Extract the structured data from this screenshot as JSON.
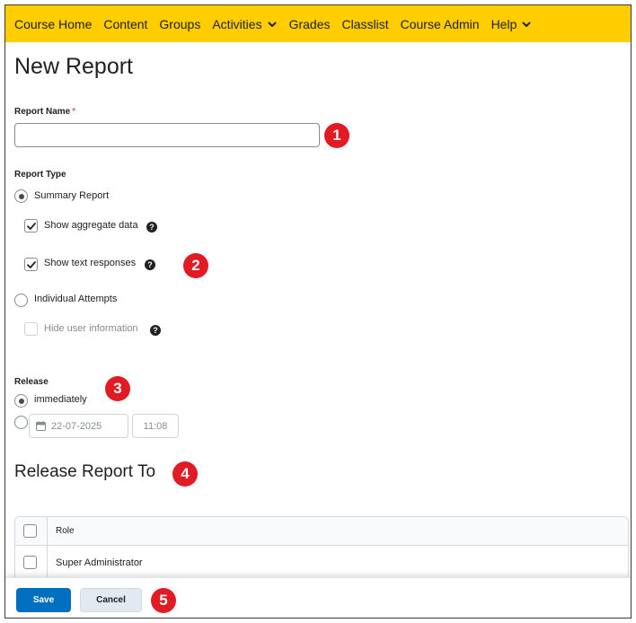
{
  "nav": {
    "items": [
      "Course Home",
      "Content",
      "Groups",
      "Activities",
      "Grades",
      "Classlist",
      "Course Admin",
      "Help"
    ]
  },
  "page": {
    "title": "New Report"
  },
  "report_name": {
    "label": "Report Name",
    "required_mark": "*",
    "value": ""
  },
  "report_type": {
    "label": "Report Type",
    "summary": "Summary Report",
    "show_aggregate": "Show aggregate data",
    "show_text": "Show text responses",
    "individual": "Individual Attempts",
    "hide_user": "Hide user information",
    "help_glyph": "?"
  },
  "release": {
    "label": "Release",
    "immediately": "immediately",
    "date": "22-07-2025",
    "time": "11:08"
  },
  "release_to": {
    "title": "Release Report To",
    "column_role": "Role",
    "rows": [
      "Super Administrator"
    ]
  },
  "footer": {
    "save": "Save",
    "cancel": "Cancel"
  },
  "badges": [
    "1",
    "2",
    "3",
    "4",
    "5"
  ],
  "colors": {
    "navbar": "#ffcd00",
    "primary": "#006fbf",
    "badge": "#e21a23"
  },
  "state": {
    "summary_selected": true,
    "show_aggregate_checked": true,
    "show_text_checked": true,
    "individual_selected": false,
    "hide_user_checked": false,
    "release_immediately": true
  }
}
